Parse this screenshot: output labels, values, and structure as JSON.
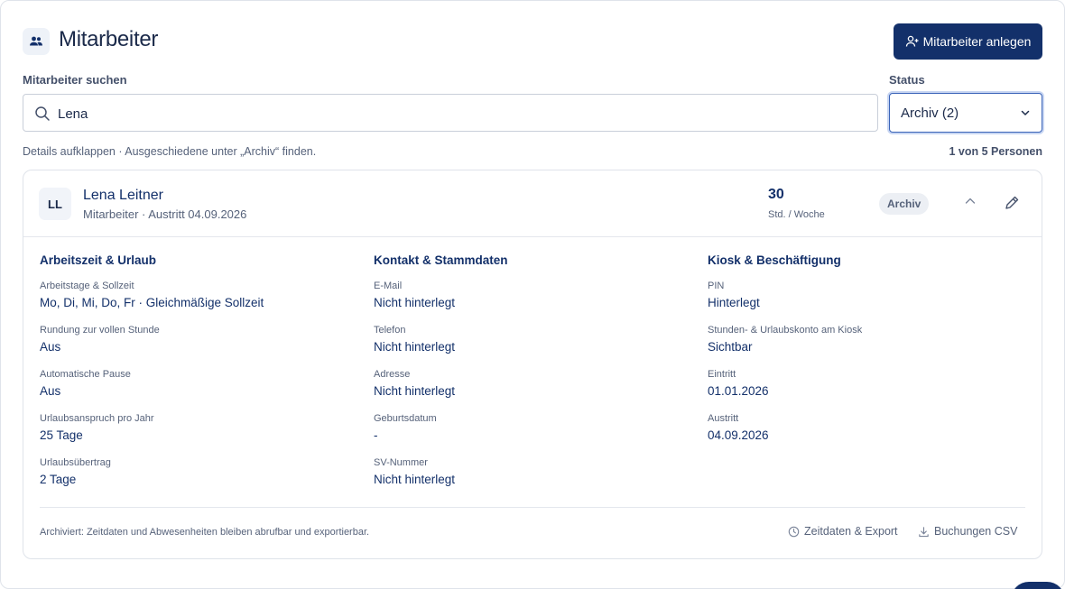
{
  "header": {
    "title": "Mitarbeiter",
    "add_label": "Mitarbeiter anlegen"
  },
  "search": {
    "label": "Mitarbeiter suchen",
    "value": "Lena",
    "placeholder": ""
  },
  "status": {
    "label": "Status",
    "value": "Archiv (2)"
  },
  "hint": "Details aufklappen · Ausgeschiedene unter „Archiv“ finden.",
  "count": "1 von 5 Personen",
  "employee": {
    "initials": "LL",
    "name": "Lena Leitner",
    "subtitle": "Mitarbeiter · Austritt 04.09.2026",
    "hours": "30",
    "hours_unit": "Std. / Woche",
    "badge": "Archiv",
    "columns": [
      {
        "title": "Arbeitszeit & Urlaub",
        "fields": [
          {
            "label": "Arbeitstage & Sollzeit",
            "value": "Mo, Di, Mi, Do, Fr · Gleichmäßige Sollzeit"
          },
          {
            "label": "Rundung zur vollen Stunde",
            "value": "Aus"
          },
          {
            "label": "Automatische Pause",
            "value": "Aus"
          },
          {
            "label": "Urlaubsanspruch pro Jahr",
            "value": "25 Tage"
          },
          {
            "label": "Urlaubsübertrag",
            "value": "2 Tage"
          }
        ]
      },
      {
        "title": "Kontakt & Stammdaten",
        "fields": [
          {
            "label": "E-Mail",
            "value": "Nicht hinterlegt"
          },
          {
            "label": "Telefon",
            "value": "Nicht hinterlegt"
          },
          {
            "label": "Adresse",
            "value": "Nicht hinterlegt"
          },
          {
            "label": "Geburtsdatum",
            "value": "-"
          },
          {
            "label": "SV-Nummer",
            "value": "Nicht hinterlegt"
          }
        ]
      },
      {
        "title": "Kiosk & Beschäftigung",
        "fields": [
          {
            "label": "PIN",
            "value": "Hinterlegt"
          },
          {
            "label": "Stunden- & Urlaubskonto am Kiosk",
            "value": "Sichtbar"
          },
          {
            "label": "Eintritt",
            "value": "01.01.2026"
          },
          {
            "label": "Austritt",
            "value": "04.09.2026"
          }
        ]
      }
    ],
    "footnote": "Archiviert: Zeitdaten und Abwesenheiten bleiben abrufbar und exportierbar.",
    "export_label": "Zeitdaten & Export",
    "csv_label": "Buchungen CSV"
  },
  "icons": {
    "title": "users-icon",
    "add": "user-plus-icon",
    "search": "search-icon",
    "status": "chevron-down-icon",
    "collapse": "chevron-up-icon",
    "edit": "pencil-icon",
    "export": "clock-icon",
    "csv": "download-icon"
  },
  "colors": {
    "primary": "#13306a",
    "text_muted": "#56627a",
    "border": "#dfe3ea",
    "focus": "#3a63b8"
  }
}
